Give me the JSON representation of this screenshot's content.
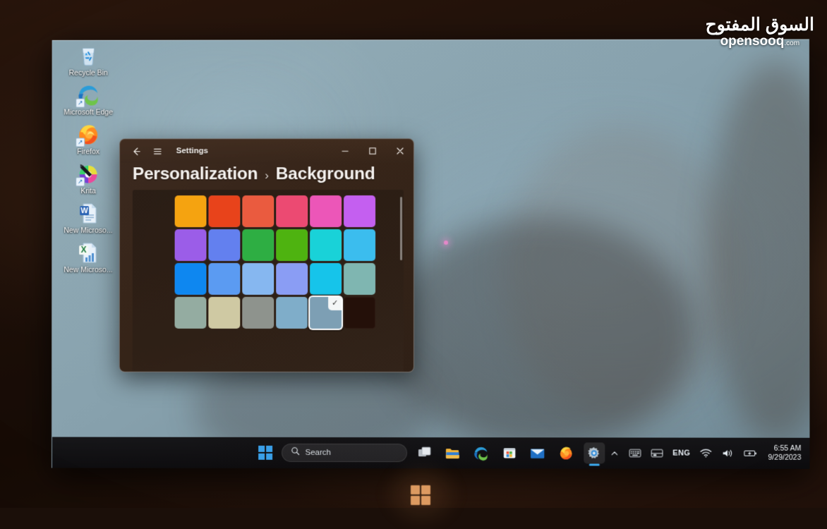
{
  "photo": {
    "watermark_arabic": "السوق المفتوح",
    "watermark_latin": "opensooq",
    "watermark_tld": ".com",
    "bezel_logo_icon": "windows-logo-icon"
  },
  "desktop": {
    "icons": [
      {
        "label": "Recycle Bin",
        "icon": "recycle-bin-icon",
        "shortcut": false
      },
      {
        "label": "Microsoft Edge",
        "icon": "microsoft-edge-icon",
        "shortcut": true
      },
      {
        "label": "Firefox",
        "icon": "firefox-icon",
        "shortcut": true
      },
      {
        "label": "Krita",
        "icon": "krita-icon",
        "shortcut": true
      },
      {
        "label": "New Microso...",
        "icon": "word-document-icon",
        "shortcut": false
      },
      {
        "label": "New Microso...",
        "icon": "excel-document-icon",
        "shortcut": false
      }
    ]
  },
  "settings_window": {
    "titlebar": {
      "back_icon": "back-arrow-icon",
      "hamburger_icon": "hamburger-menu-icon",
      "title": "Settings",
      "minimize_icon": "minimize-icon",
      "maximize_icon": "maximize-icon",
      "close_icon": "close-icon"
    },
    "breadcrumb": {
      "parent": "Personalization",
      "separator": "›",
      "current": "Background"
    },
    "accent_selected_color": "#7d9fb4",
    "color_grid": {
      "columns": 6,
      "rows": 4,
      "selected_index": 22,
      "swatches": [
        "#f5a310",
        "#e8431b",
        "#ea5b3f",
        "#ec4a72",
        "#ec56b8",
        "#c45ff0",
        "#9b5de8",
        "#6380ef",
        "#2eae43",
        "#4eb310",
        "#19d2d8",
        "#3bbdee",
        "#0e87f0",
        "#5b9bf2",
        "#86b7f0",
        "#8a9df4",
        "#16c4ea",
        "#7fb6b1",
        "#94aca1",
        "#cfc9a3",
        "#8e938d",
        "#7fadc9",
        "#7d9fb4",
        "#241009"
      ]
    }
  },
  "taskbar": {
    "start_icon": "windows-start-icon",
    "search": {
      "icon": "search-icon",
      "placeholder": "Search"
    },
    "apps": [
      {
        "name": "task-view",
        "icon": "task-view-icon",
        "active": false
      },
      {
        "name": "file-explorer",
        "icon": "file-explorer-icon",
        "active": false
      },
      {
        "name": "microsoft-edge",
        "icon": "microsoft-edge-icon",
        "active": false
      },
      {
        "name": "microsoft-store",
        "icon": "microsoft-store-icon",
        "active": false
      },
      {
        "name": "mail",
        "icon": "mail-icon",
        "active": false
      },
      {
        "name": "firefox",
        "icon": "firefox-icon",
        "active": false
      },
      {
        "name": "settings",
        "icon": "settings-gear-icon",
        "active": true
      }
    ],
    "tray": {
      "overflow_icon": "chevron-up-icon",
      "keyboard_icon": "touch-keyboard-icon",
      "display_icon": "display-switch-icon",
      "language": "ENG",
      "wifi_icon": "wifi-icon",
      "volume_icon": "speaker-icon",
      "battery_icon": "battery-charging-icon",
      "time": "6:55 AM",
      "date": "9/29/2023"
    }
  }
}
